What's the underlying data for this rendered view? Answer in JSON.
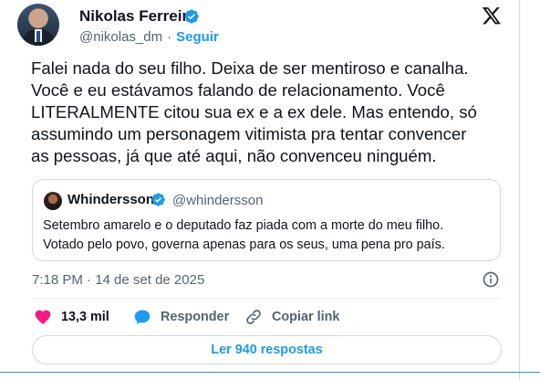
{
  "author": {
    "name": "Nikolas Ferreira",
    "handle": "@nikolas_dm",
    "separator": "·",
    "follow_label": "Seguir"
  },
  "platform_icon": "x-logo-icon",
  "tweet": {
    "text": "Falei nada do seu filho. Deixa de ser mentiroso e canalha.\nVocê e eu estávamos falando de relacionamento. Você\nLITERALMENTE citou sua ex e a ex dele. Mas entendo, só\nassumindo um personagem vitimista pra tentar convencer\nas pessoas, já que até aqui, não convenceu ninguém."
  },
  "quoted_tweet": {
    "name": "Whindersson",
    "handle": "@whindersson",
    "text": "Setembro amarelo e o deputado faz piada com a morte do meu filho.\nVotado pelo povo, governa apenas para os seus, uma pena pro país."
  },
  "timestamp": "7:18 PM · 14 de set de 2025",
  "actions": {
    "like_count": "13,3 mil",
    "reply_label": "Responder",
    "copy_label": "Copiar link"
  },
  "replies_button": "Ler 940 respostas",
  "colors": {
    "accent": "#1d9bf0",
    "like": "#f91880",
    "text": "#0f1419",
    "secondary": "#536471",
    "border": "#cfd9de"
  }
}
